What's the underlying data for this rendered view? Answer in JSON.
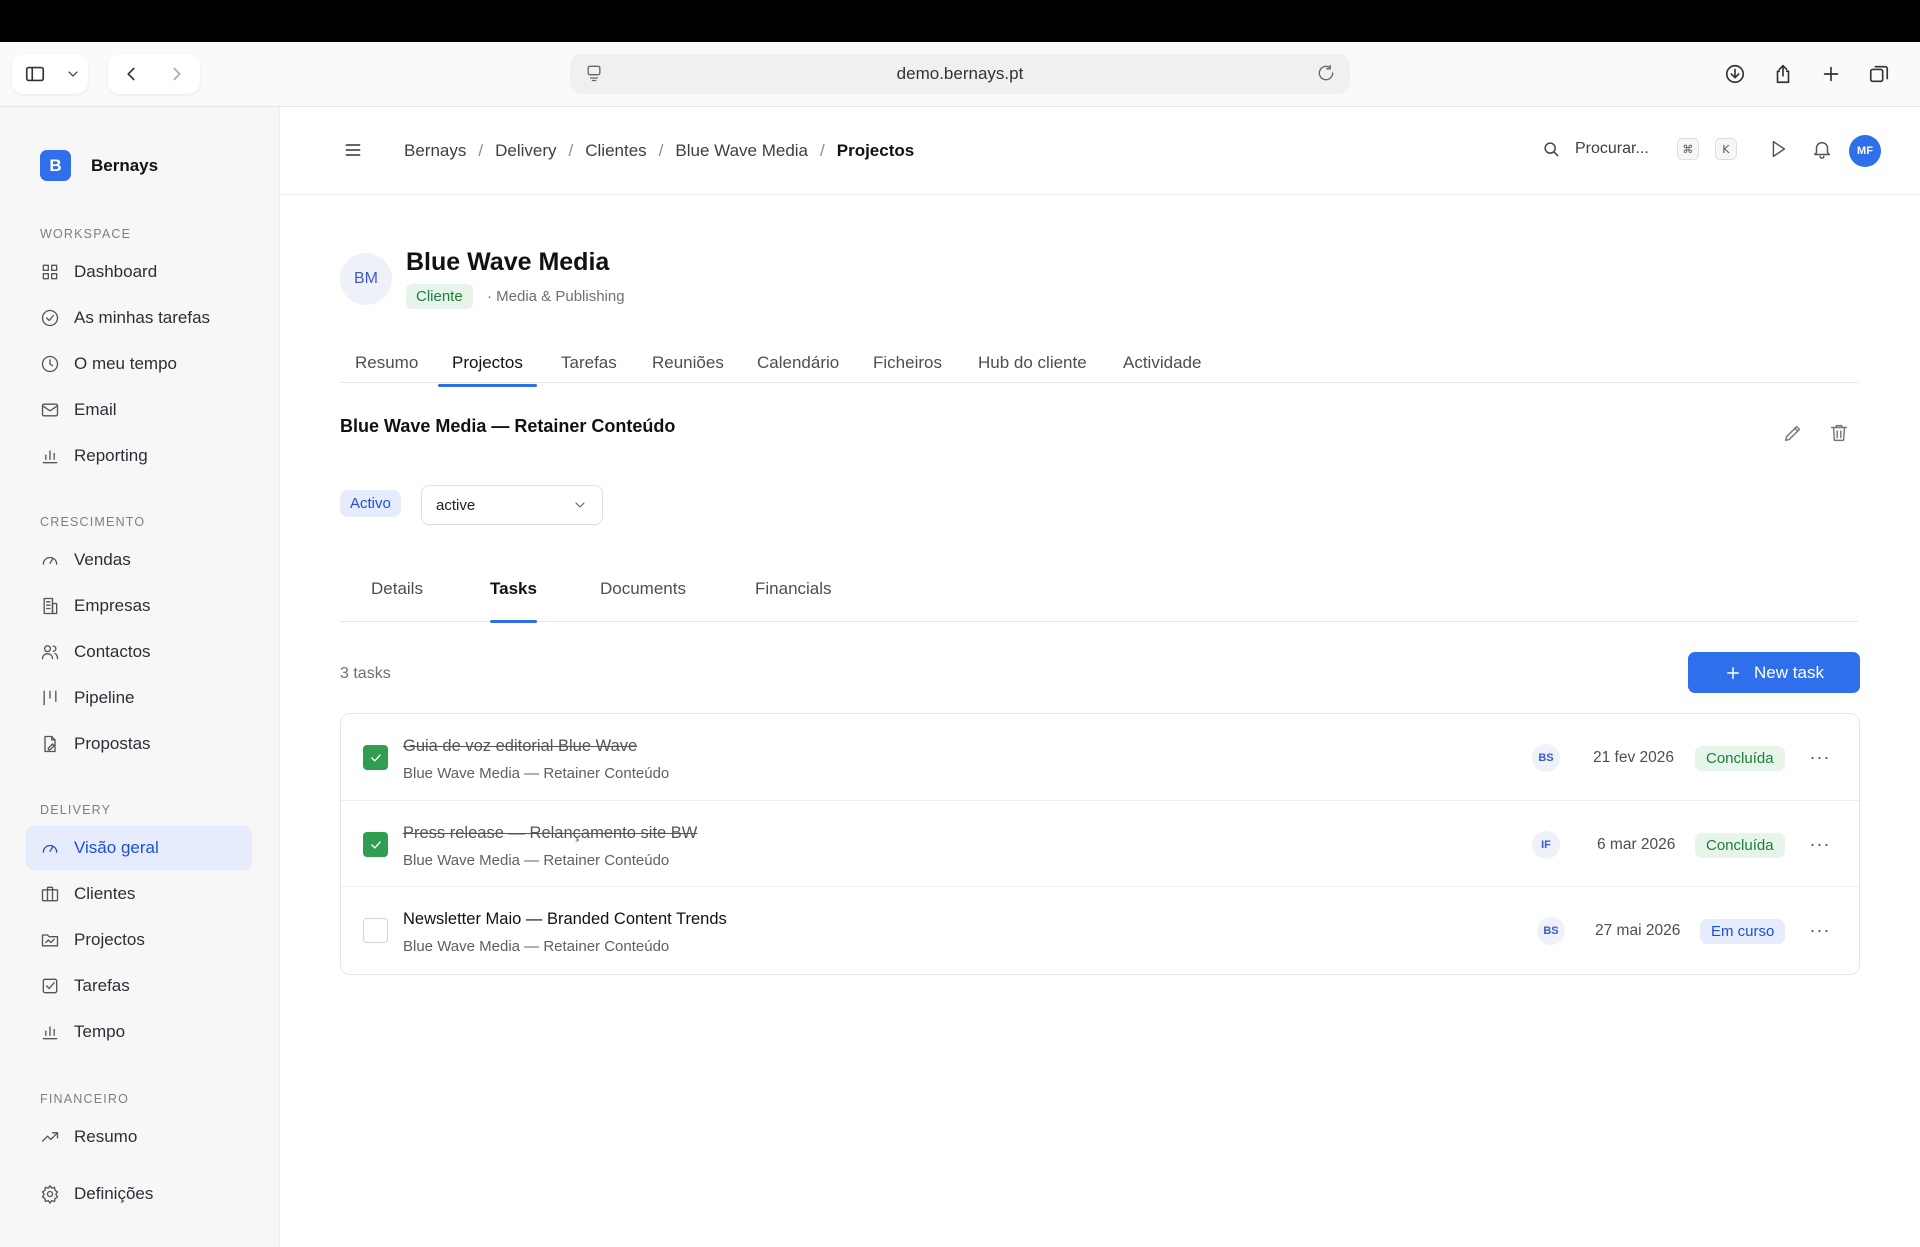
{
  "browser": {
    "url": "demo.bernays.pt"
  },
  "sidebar": {
    "brand": {
      "logo_letter": "B",
      "name": "Bernays"
    },
    "sections": [
      {
        "label": "WORKSPACE",
        "items": [
          {
            "label": "Dashboard",
            "icon": "grid-icon"
          },
          {
            "label": "As minhas tarefas",
            "icon": "check-circle-icon"
          },
          {
            "label": "O meu tempo",
            "icon": "clock-icon"
          },
          {
            "label": "Email",
            "icon": "mail-icon"
          },
          {
            "label": "Reporting",
            "icon": "bar-chart-icon"
          }
        ]
      },
      {
        "label": "CRESCIMENTO",
        "items": [
          {
            "label": "Vendas",
            "icon": "gauge-icon"
          },
          {
            "label": "Empresas",
            "icon": "building-icon"
          },
          {
            "label": "Contactos",
            "icon": "users-icon"
          },
          {
            "label": "Pipeline",
            "icon": "pipeline-icon"
          },
          {
            "label": "Propostas",
            "icon": "document-edit-icon"
          }
        ]
      },
      {
        "label": "DELIVERY",
        "items": [
          {
            "label": "Visão geral",
            "icon": "gauge-icon",
            "active": true
          },
          {
            "label": "Clientes",
            "icon": "briefcase-icon"
          },
          {
            "label": "Projectos",
            "icon": "folder-icon"
          },
          {
            "label": "Tarefas",
            "icon": "checkbox-icon"
          },
          {
            "label": "Tempo",
            "icon": "bar-chart-icon"
          }
        ]
      },
      {
        "label": "FINANCEIRO",
        "items": [
          {
            "label": "Resumo",
            "icon": "trend-up-icon"
          }
        ]
      }
    ],
    "settings_label": "Definições"
  },
  "header": {
    "breadcrumb": [
      "Bernays",
      "Delivery",
      "Clientes",
      "Blue Wave Media",
      "Projectos"
    ],
    "breadcrumb_sep": "/",
    "search_placeholder": "Procurar...",
    "shortcut_keys": [
      "⌘",
      "K"
    ],
    "user_initials": "MF"
  },
  "client": {
    "initials": "BM",
    "name": "Blue Wave Media",
    "type_tag": "Cliente",
    "meta": "· Media & Publishing",
    "tabs": [
      "Resumo",
      "Projectos",
      "Tarefas",
      "Reuniões",
      "Calendário",
      "Ficheiros",
      "Hub do cliente",
      "Actividade"
    ],
    "active_tab": "Projectos"
  },
  "project": {
    "title": "Blue Wave Media — Retainer Conteúdo",
    "status_badge": "Activo",
    "status_select_value": "active",
    "tabs": [
      "Details",
      "Tasks",
      "Documents",
      "Financials"
    ],
    "active_tab": "Tasks",
    "task_count_label": "3 tasks",
    "new_task_label": "New task",
    "tasks": [
      {
        "title": "Guia de voz editorial Blue Wave",
        "project": "Blue Wave Media — Retainer Conteúdo",
        "assignee": "BS",
        "due": "21 fev 2026",
        "status": "Concluída",
        "done": true
      },
      {
        "title": "Press release — Relançamento site BW",
        "project": "Blue Wave Media — Retainer Conteúdo",
        "assignee": "IF",
        "due": "6 mar 2026",
        "status": "Concluída",
        "done": true
      },
      {
        "title": "Newsletter Maio — Branded Content Trends",
        "project": "Blue Wave Media — Retainer Conteúdo",
        "assignee": "BS",
        "due": "27 mai 2026",
        "status": "Em curso",
        "done": false
      }
    ],
    "more_glyph": "···"
  },
  "colors": {
    "accent": "#2f6fec",
    "success": "#2f9e51",
    "success_bg": "#e6f4ea",
    "info_bg": "#e6ecfb"
  }
}
